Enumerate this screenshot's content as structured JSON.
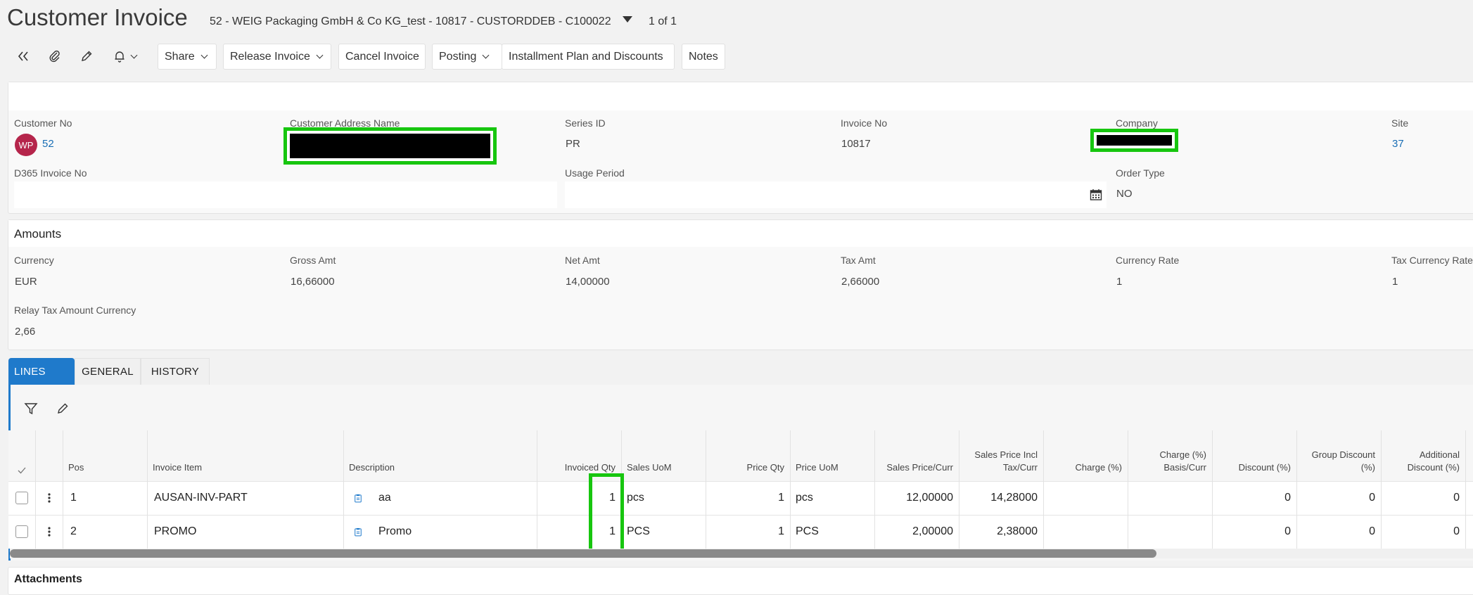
{
  "header": {
    "title": "Customer Invoice",
    "record_description": "52 - WEIG Packaging GmbH & Co KG_test - 10817 - CUSTORDDEB - C100022",
    "record_count": "1 of 1"
  },
  "toolbar": {
    "share": "Share",
    "release_invoice": "Release Invoice",
    "cancel_invoice": "Cancel Invoice",
    "posting": "Posting",
    "installment_plan": "Installment Plan and Discounts",
    "notes": "Notes"
  },
  "details": {
    "customer_no_label": "Customer No",
    "customer_initials": "WP",
    "customer_no": "52",
    "customer_address_name_label": "Customer Address Name",
    "series_id_label": "Series ID",
    "series_id": "PR",
    "invoice_no_label": "Invoice No",
    "invoice_no": "10817",
    "company_label": "Company",
    "site_label": "Site",
    "site": "37",
    "d365_invoice_no_label": "D365 Invoice No",
    "d365_invoice_no": "",
    "usage_period_label": "Usage Period",
    "usage_period": "",
    "order_type_label": "Order Type",
    "order_type": "NO"
  },
  "amounts": {
    "title": "Amounts",
    "currency_label": "Currency",
    "currency": "EUR",
    "gross_amt_label": "Gross Amt",
    "gross_amt": "16,66000",
    "net_amt_label": "Net Amt",
    "net_amt": "14,00000",
    "tax_amt_label": "Tax Amt",
    "tax_amt": "2,66000",
    "currency_rate_label": "Currency Rate",
    "currency_rate": "1",
    "tax_currency_rate_label": "Tax Currency Rate",
    "tax_currency_rate": "1",
    "relay_tax_label": "Relay Tax Amount Currency",
    "relay_tax": "2,66"
  },
  "tabs": [
    "LINES",
    "GENERAL",
    "HISTORY"
  ],
  "lines": {
    "columns": {
      "pos": "Pos",
      "invoice_item": "Invoice Item",
      "description": "Description",
      "invoiced_qty": "Invoiced Qty",
      "sales_uom": "Sales UoM",
      "price_qty": "Price Qty",
      "price_uom": "Price UoM",
      "sales_price_curr": "Sales Price/Curr",
      "sales_price_incl_tax_curr": "Sales Price Incl Tax/Curr",
      "charge_pct": "Charge (%)",
      "charge_pct_basis_curr": "Charge (%) Basis/Curr",
      "discount_pct": "Discount (%)",
      "group_discount_pct": "Group Discount (%)",
      "additional_discount_pct": "Additional Discount (%)"
    },
    "rows": [
      {
        "pos": "1",
        "invoice_item": "AUSAN-INV-PART",
        "description": "aa",
        "invoiced_qty": "1",
        "sales_uom": "pcs",
        "price_qty": "1",
        "price_uom": "pcs",
        "sales_price_curr": "12,00000",
        "sales_price_incl_tax_curr": "14,28000",
        "charge_pct": "",
        "charge_pct_basis_curr": "",
        "discount_pct": "0",
        "group_discount_pct": "0",
        "additional_discount_pct": "0"
      },
      {
        "pos": "2",
        "invoice_item": "PROMO",
        "description": "Promo",
        "invoiced_qty": "1",
        "sales_uom": "PCS",
        "price_qty": "1",
        "price_uom": "PCS",
        "sales_price_curr": "2,00000",
        "sales_price_incl_tax_curr": "2,38000",
        "charge_pct": "",
        "charge_pct_basis_curr": "",
        "discount_pct": "0",
        "group_discount_pct": "0",
        "additional_discount_pct": "0"
      }
    ]
  },
  "attachments_title": "Attachments",
  "colors": {
    "accent": "#1f7acb",
    "avatar": "#b5254b",
    "highlight": "#17c60f",
    "link": "#1a6fb5"
  }
}
